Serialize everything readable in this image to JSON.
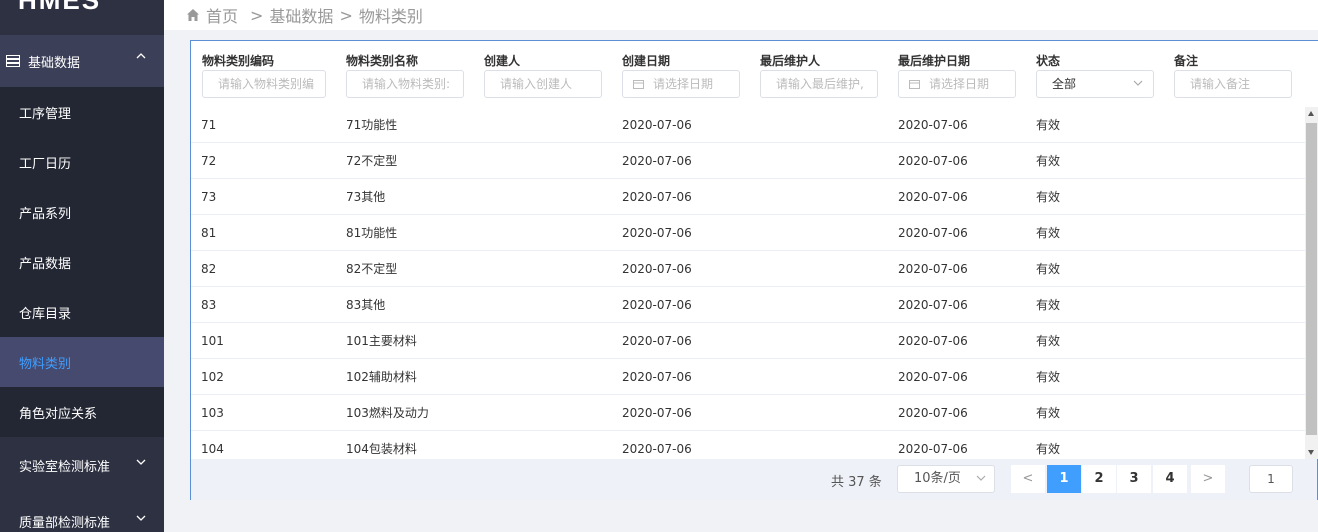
{
  "app": {
    "logo": "HMES"
  },
  "sidebar": {
    "group": {
      "label": "基础数据"
    },
    "items": [
      {
        "label": "工序管理"
      },
      {
        "label": "工厂日历"
      },
      {
        "label": "产品系列"
      },
      {
        "label": "产品数据"
      },
      {
        "label": "仓库目录"
      },
      {
        "label": "物料类别"
      },
      {
        "label": "角色对应关系"
      }
    ],
    "groups_lower": [
      {
        "label": "实验室检测标准"
      },
      {
        "label": "质量部检测标准"
      }
    ]
  },
  "breadcrumb": {
    "home": "首页",
    "sep1": ">",
    "level1": "基础数据",
    "sep2": ">",
    "level2": "物料类别"
  },
  "filters": {
    "code": {
      "label": "物料类别编码",
      "placeholder": "请输入物料类别编"
    },
    "name": {
      "label": "物料类别名称",
      "placeholder": "请输入物料类别:"
    },
    "creator": {
      "label": "创建人",
      "placeholder": "请输入创建人"
    },
    "create_date": {
      "label": "创建日期",
      "placeholder": "请选择日期"
    },
    "maintainer": {
      "label": "最后维护人",
      "placeholder": "请输入最后维护,"
    },
    "maintain_date": {
      "label": "最后维护日期",
      "placeholder": "请选择日期"
    },
    "status": {
      "label": "状态",
      "value": "全部"
    },
    "remark": {
      "label": "备注",
      "placeholder": "请输入备注"
    }
  },
  "rows": [
    {
      "code": "71",
      "name": "71功能性",
      "creator": "",
      "create_date": "2020-07-06",
      "maintainer": "",
      "maintain_date": "2020-07-06",
      "status": "有效",
      "remark": ""
    },
    {
      "code": "72",
      "name": "72不定型",
      "creator": "",
      "create_date": "2020-07-06",
      "maintainer": "",
      "maintain_date": "2020-07-06",
      "status": "有效",
      "remark": ""
    },
    {
      "code": "73",
      "name": "73其他",
      "creator": "",
      "create_date": "2020-07-06",
      "maintainer": "",
      "maintain_date": "2020-07-06",
      "status": "有效",
      "remark": ""
    },
    {
      "code": "81",
      "name": "81功能性",
      "creator": "",
      "create_date": "2020-07-06",
      "maintainer": "",
      "maintain_date": "2020-07-06",
      "status": "有效",
      "remark": ""
    },
    {
      "code": "82",
      "name": "82不定型",
      "creator": "",
      "create_date": "2020-07-06",
      "maintainer": "",
      "maintain_date": "2020-07-06",
      "status": "有效",
      "remark": ""
    },
    {
      "code": "83",
      "name": "83其他",
      "creator": "",
      "create_date": "2020-07-06",
      "maintainer": "",
      "maintain_date": "2020-07-06",
      "status": "有效",
      "remark": ""
    },
    {
      "code": "101",
      "name": "101主要材料",
      "creator": "",
      "create_date": "2020-07-06",
      "maintainer": "",
      "maintain_date": "2020-07-06",
      "status": "有效",
      "remark": ""
    },
    {
      "code": "102",
      "name": "102辅助材料",
      "creator": "",
      "create_date": "2020-07-06",
      "maintainer": "",
      "maintain_date": "2020-07-06",
      "status": "有效",
      "remark": ""
    },
    {
      "code": "103",
      "name": "103燃料及动力",
      "creator": "",
      "create_date": "2020-07-06",
      "maintainer": "",
      "maintain_date": "2020-07-06",
      "status": "有效",
      "remark": ""
    },
    {
      "code": "104",
      "name": "104包装材料",
      "creator": "",
      "create_date": "2020-07-06",
      "maintainer": "",
      "maintain_date": "2020-07-06",
      "status": "有效",
      "remark": ""
    }
  ],
  "pagination": {
    "total": "共 37 条",
    "page_size": "10条/页",
    "pages": [
      "1",
      "2",
      "3",
      "4"
    ],
    "current": "1",
    "prev": "<",
    "next": ">",
    "jump_value": "1"
  },
  "colors": {
    "accent": "#409eff",
    "sidebar_bg": "#2d3142",
    "active_item_bg": "#454a6e"
  }
}
